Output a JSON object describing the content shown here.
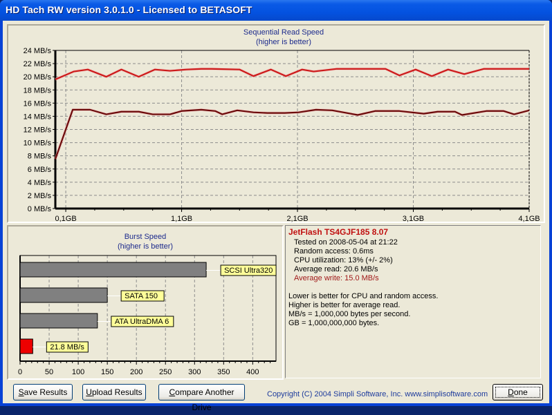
{
  "window": {
    "title": "HD Tach RW version 3.0.1.0 - Licensed to BETASOFT"
  },
  "colors": {
    "read": "#cc1a1a",
    "write": "#6b0a0a",
    "drive_bar": "#ee0000",
    "ref_bar": "#808080",
    "label_bg": "#ffff99",
    "title_text": "#1c2a8c"
  },
  "chart_data": [
    {
      "type": "line",
      "title": "Sequential Read Speed",
      "subtitle": "(higher is better)",
      "xlabel": "",
      "ylabel": "",
      "ylim": [
        0,
        24
      ],
      "xlim": [
        0.01,
        4.1
      ],
      "yticks": [
        "0 MB/s",
        "2 MB/s",
        "4 MB/s",
        "6 MB/s",
        "8 MB/s",
        "10 MB/s",
        "12 MB/s",
        "14 MB/s",
        "16 MB/s",
        "18 MB/s",
        "20 MB/s",
        "22 MB/s",
        "24 MB/s"
      ],
      "xticks": [
        {
          "value": 0.1,
          "label": "0,1GB"
        },
        {
          "value": 1.1,
          "label": "1,1GB"
        },
        {
          "value": 2.1,
          "label": "2,1GB"
        },
        {
          "value": 3.1,
          "label": "3,1GB"
        },
        {
          "value": 4.1,
          "label": "4,1GB"
        }
      ],
      "grid": true,
      "series": [
        {
          "name": "Read",
          "color": "#cc1a1a",
          "x": [
            0.01,
            0.17,
            0.29,
            0.45,
            0.58,
            0.73,
            0.87,
            1.0,
            1.14,
            1.27,
            1.36,
            1.6,
            1.72,
            1.87,
            2.0,
            2.14,
            2.24,
            2.44,
            2.86,
            2.98,
            3.12,
            3.26,
            3.4,
            3.54,
            3.71,
            4.1
          ],
          "y": [
            19.6,
            20.8,
            21.1,
            20.0,
            21.1,
            20.0,
            21.1,
            20.9,
            21.1,
            21.2,
            21.2,
            21.1,
            20.1,
            21.1,
            20.1,
            21.1,
            20.8,
            21.2,
            21.2,
            20.2,
            21.1,
            20.1,
            21.1,
            20.4,
            21.2,
            21.2
          ]
        },
        {
          "name": "Write",
          "color": "#6b0a0a",
          "x": [
            0.01,
            0.16,
            0.31,
            0.45,
            0.58,
            0.73,
            0.85,
            1.0,
            1.1,
            1.27,
            1.39,
            1.45,
            1.58,
            1.72,
            1.84,
            1.99,
            2.11,
            2.26,
            2.4,
            2.62,
            2.77,
            2.98,
            3.19,
            3.31,
            3.46,
            3.52,
            3.73,
            3.88,
            3.97,
            4.1
          ],
          "y": [
            7.5,
            15.0,
            15.0,
            14.3,
            14.7,
            14.7,
            14.3,
            14.3,
            14.8,
            15.0,
            14.8,
            14.3,
            14.9,
            14.6,
            14.5,
            14.5,
            14.6,
            15.0,
            14.9,
            14.2,
            14.8,
            14.8,
            14.4,
            14.7,
            14.7,
            14.2,
            14.8,
            14.8,
            14.3,
            14.9
          ]
        }
      ]
    },
    {
      "type": "bar",
      "orientation": "horizontal",
      "title": "Burst Speed",
      "subtitle": "(higher is better)",
      "xlim": [
        0,
        440
      ],
      "xticks": [
        0,
        50,
        100,
        150,
        200,
        250,
        300,
        350,
        400
      ],
      "grid": true,
      "categories": [
        "SCSI Ultra320",
        "SATA 150",
        "ATA UltraDMA 6",
        "21.8 MB/s"
      ],
      "values": [
        320,
        150,
        133,
        21.8
      ],
      "bar_colors": [
        "#808080",
        "#808080",
        "#808080",
        "#ee0000"
      ]
    }
  ],
  "info": {
    "drive_name": "JetFlash TS4GJF185 8.07",
    "tested_on": "Tested on 2008-05-04 at 21:22",
    "random_access": "Random access: 0.6ms",
    "cpu_utilization": "CPU utilization: 13% (+/- 2%)",
    "average_read": "Average read: 20.6 MB/s",
    "average_write": "Average write: 15.0 MB/s",
    "notes": [
      "Lower is better for CPU and random access.",
      "Higher is better for average read.",
      "MB/s = 1,000,000 bytes per second.",
      "GB = 1,000,000,000 bytes."
    ]
  },
  "buttons": {
    "save": {
      "mnemonic": "S",
      "rest": "ave Results"
    },
    "upload": {
      "mnemonic": "U",
      "rest": "pload Results"
    },
    "compare": {
      "mnemonic": "C",
      "rest": "ompare Another Drive"
    },
    "done": {
      "mnemonic": "D",
      "rest": "one"
    }
  },
  "copyright": "Copyright (C) 2004 Simpli Software, Inc. www.simplisoftware.com"
}
